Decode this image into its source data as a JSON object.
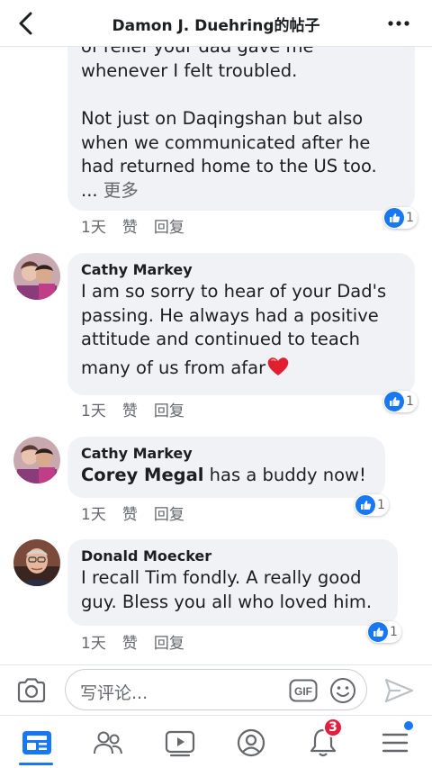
{
  "header": {
    "title": "Damon J. Duehring的帖子"
  },
  "comments": [
    {
      "author": "",
      "text_cut_top": "of relief your dad gave me",
      "text_lines": [
        "whenever I felt troubled.",
        "",
        "Not just on Daqingshan but also",
        "when we communicated after he",
        "had returned home to the US too."
      ],
      "more_prefix": "... ",
      "more_label": "更多",
      "time": "1天",
      "like_label": "赞",
      "reply_label": "回复",
      "reaction_count": "1"
    },
    {
      "author": "Cathy Markey",
      "text_lines": [
        "I am so sorry to hear of your Dad's",
        "passing. He always had a positive",
        "attitude and continued to teach",
        "many of us from afar"
      ],
      "time": "1天",
      "like_label": "赞",
      "reply_label": "回复",
      "reaction_count": "1"
    },
    {
      "author": "Cathy Markey",
      "tagged_name": "Corey Megal",
      "text": " has a buddy now!",
      "time": "1天",
      "like_label": "赞",
      "reply_label": "回复",
      "reaction_count": "1"
    },
    {
      "author": "Donald Moecker",
      "text_lines": [
        "I recall Tim fondly. A really good",
        "guy. Bless you all who loved him."
      ],
      "time": "1天",
      "like_label": "赞",
      "reply_label": "回复",
      "reaction_count": "1"
    }
  ],
  "composer": {
    "placeholder": "写评论...",
    "gif_label": "GIF"
  },
  "tabbar": {
    "notifications_badge": "3"
  },
  "colors": {
    "accent": "#1877f2",
    "bubble": "#f0f2f5",
    "badge": "#e41e3f"
  }
}
